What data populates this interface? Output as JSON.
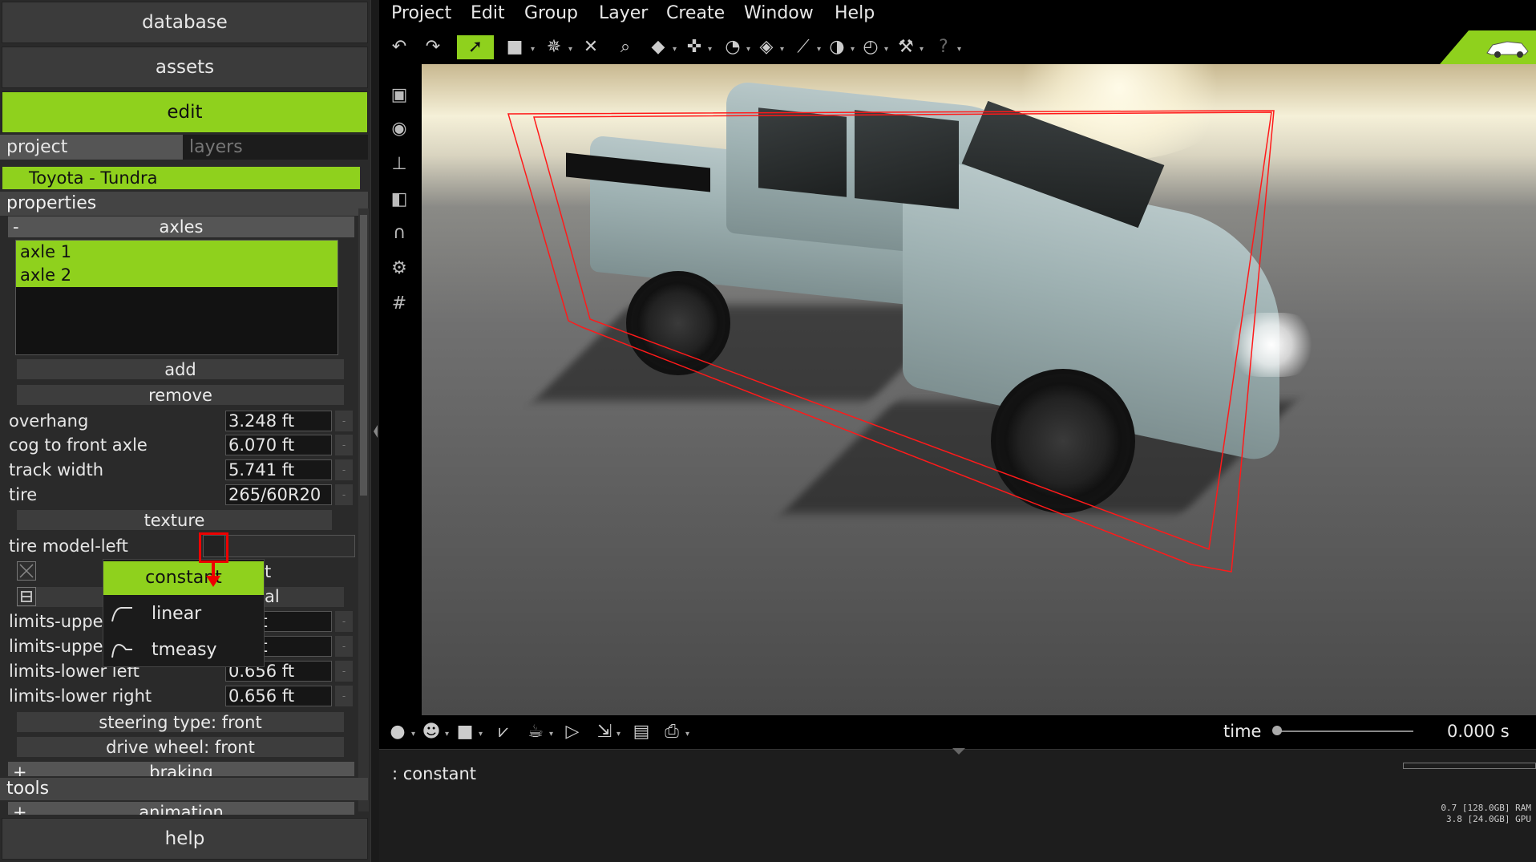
{
  "left_panel": {
    "nav": {
      "database": "database",
      "assets": "assets",
      "edit": "edit",
      "help": "help"
    },
    "tabs": {
      "project": "project",
      "layers": "layers"
    },
    "project_item": "Toyota - Tundra",
    "properties_header": "properties",
    "axles_header": {
      "sign": "-",
      "label": "axles"
    },
    "axles_list": [
      "axle 1",
      "axle 2"
    ],
    "add_button": "add",
    "remove_button": "remove",
    "props": [
      {
        "label": "overhang",
        "value": "3.248 ft"
      },
      {
        "label": "cog to front axle",
        "value": "6.070 ft"
      },
      {
        "label": "track width",
        "value": "5.741 ft"
      },
      {
        "label": "tire",
        "value": "265/60R20"
      }
    ],
    "texture_button": "texture",
    "tire_model_left": "tire model-left",
    "partial_t": "t",
    "partial_al": "al",
    "limits": [
      {
        "label": "limits-uppe",
        "value": "56 ft"
      },
      {
        "label": "limits-uppe",
        "value": "56 ft"
      },
      {
        "label": "limits-lower left",
        "value": "0.656 ft"
      },
      {
        "label": "limits-lower right",
        "value": "0.656 ft"
      }
    ],
    "steering_type": "steering type: front",
    "drive_wheel": "drive wheel: front",
    "braking_header": {
      "sign": "+",
      "label": "braking"
    },
    "tools_header": "tools",
    "animation_header": {
      "sign": "+",
      "label": "animation"
    }
  },
  "dropdown": {
    "items": [
      {
        "label": "constant",
        "icon": "constant-curve-icon",
        "selected": true
      },
      {
        "label": "linear",
        "icon": "linear-curve-icon",
        "selected": false
      },
      {
        "label": "tmeasy",
        "icon": "tmeasy-curve-icon",
        "selected": false
      }
    ]
  },
  "menubar": [
    "Project",
    "Edit",
    "Group",
    "Layer",
    "Create",
    "Window",
    "Help"
  ],
  "toolbar_icons": [
    "undo-icon",
    "redo-icon",
    "select-icon",
    "box-select-icon",
    "joint-icon",
    "delete-icon",
    "zoom-icon",
    "cube-icon",
    "move-icon",
    "gauge-icon",
    "ruler-icon",
    "measure-icon",
    "compass-icon",
    "dial-icon",
    "wrench-icon",
    "help-icon"
  ],
  "side_icons": [
    "camera-icon",
    "target-icon",
    "axis-icon",
    "film-icon",
    "magnet-icon",
    "gear-icon",
    "grid-icon"
  ],
  "bottom_icons": [
    "sphere-icon",
    "head-icon",
    "square-icon",
    "graph-icon",
    "teapot-icon",
    "play-icon",
    "export-icon",
    "clipboard-icon",
    "print-icon"
  ],
  "timeline": {
    "label": "time",
    "value": "0.000 s",
    "position": 0
  },
  "console": {
    "text": ": constant",
    "stats": [
      "0.7 [128.0GB] RAM",
      "3.8 [24.0GB] GPU"
    ]
  },
  "colors": {
    "accent": "#8fd11d",
    "highlight": "#e00000"
  }
}
